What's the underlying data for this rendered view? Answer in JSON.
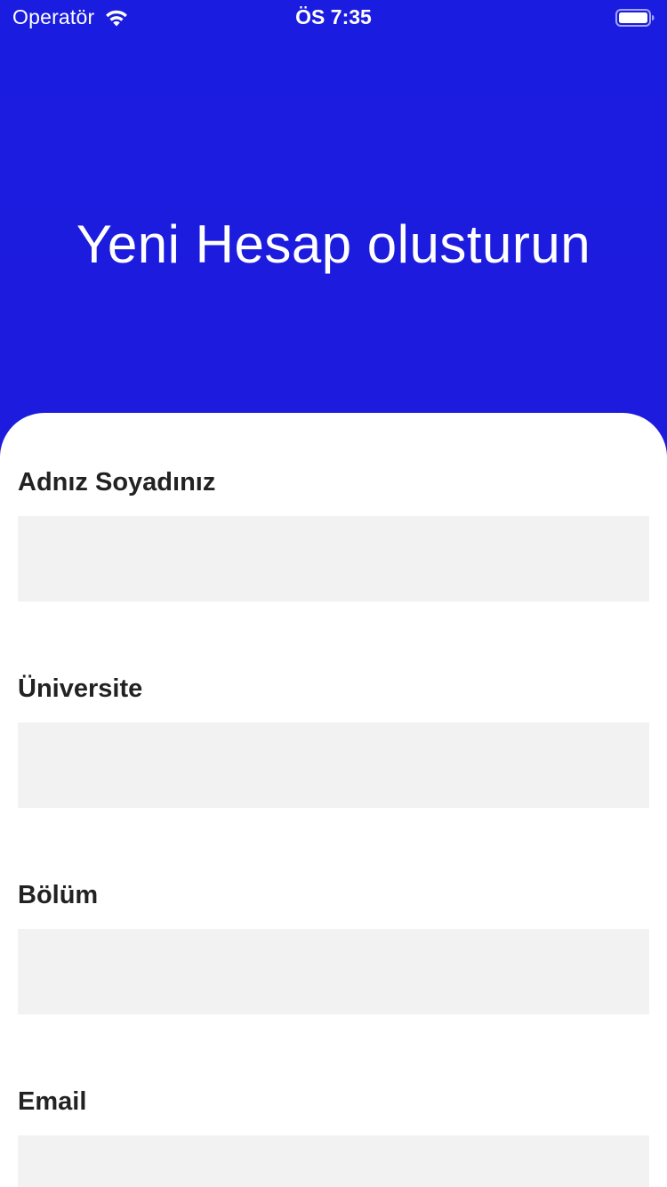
{
  "status_bar": {
    "carrier": "Operatör",
    "time": "ÖS 7:35",
    "wifi_icon": "wifi-icon",
    "battery_icon": "battery-icon"
  },
  "header": {
    "title": "Yeni Hesap olusturun",
    "background_color": "#1d1bdc"
  },
  "form": {
    "fields": [
      {
        "label": "Adnız Soyadınız",
        "value": "",
        "placeholder": ""
      },
      {
        "label": "Üniversite",
        "value": "",
        "placeholder": ""
      },
      {
        "label": "Bölüm",
        "value": "",
        "placeholder": ""
      },
      {
        "label": "Email",
        "value": "",
        "placeholder": ""
      }
    ],
    "input_background": "#f2f2f2"
  }
}
